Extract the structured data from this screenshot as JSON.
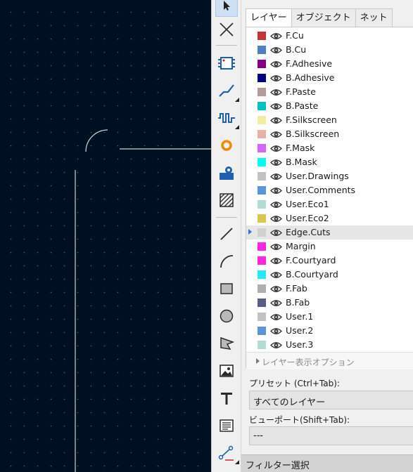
{
  "tabs": [
    {
      "label": "レイヤー",
      "active": true
    },
    {
      "label": "オブジェクト",
      "active": false
    },
    {
      "label": "ネット",
      "active": false
    }
  ],
  "layers": [
    {
      "name": "F.Cu",
      "color": "#c83434",
      "selected": false
    },
    {
      "name": "B.Cu",
      "color": "#4d7fc4",
      "selected": false
    },
    {
      "name": "F.Adhesive",
      "color": "#840084",
      "selected": false
    },
    {
      "name": "B.Adhesive",
      "color": "#000084",
      "selected": false
    },
    {
      "name": "F.Paste",
      "color": "#b49b9b",
      "selected": false
    },
    {
      "name": "B.Paste",
      "color": "#00c2c2",
      "selected": false
    },
    {
      "name": "F.Silkscreen",
      "color": "#f2eda1",
      "selected": false
    },
    {
      "name": "B.Silkscreen",
      "color": "#e8b2a7",
      "selected": false
    },
    {
      "name": "F.Mask",
      "color": "#d864ff",
      "selected": false
    },
    {
      "name": "B.Mask",
      "color": "#02ffee",
      "selected": false
    },
    {
      "name": "User.Drawings",
      "color": "#c2c2c2",
      "selected": false
    },
    {
      "name": "User.Comments",
      "color": "#5994dc",
      "selected": false
    },
    {
      "name": "User.Eco1",
      "color": "#b4dbd2",
      "selected": false
    },
    {
      "name": "User.Eco2",
      "color": "#d8c852",
      "selected": false
    },
    {
      "name": "Edge.Cuts",
      "color": "#d0d2cd",
      "selected": true
    },
    {
      "name": "Margin",
      "color": "#ff26e2",
      "selected": false
    },
    {
      "name": "F.Courtyard",
      "color": "#ff26e2",
      "selected": false
    },
    {
      "name": "B.Courtyard",
      "color": "#26e9ff",
      "selected": false
    },
    {
      "name": "F.Fab",
      "color": "#afafaf",
      "selected": false
    },
    {
      "name": "B.Fab",
      "color": "#585d84",
      "selected": false
    },
    {
      "name": "User.1",
      "color": "#c2c2c2",
      "selected": false
    },
    {
      "name": "User.2",
      "color": "#5994dc",
      "selected": false
    },
    {
      "name": "User.3",
      "color": "#b4dbd2",
      "selected": false
    }
  ],
  "layer_display_options": "レイヤー表示オプション",
  "preset": {
    "label": "プリセット (Ctrl+Tab):",
    "value": "すべてのレイヤー"
  },
  "viewport": {
    "label": "ビューポート(Shift+Tab):",
    "value": "---"
  },
  "filter_section": "フィルター選択",
  "toolbar_tools": [
    "select-tool",
    "local-ratsnest-tool",
    "footprint-tool",
    "route-track-tool",
    "tune-length-tool",
    "via-tool",
    "add-pad-tool",
    "zone-tool",
    "line-tool",
    "arc-tool",
    "rectangle-tool",
    "circle-tool",
    "polygon-tool",
    "image-tool",
    "text-tool",
    "textbox-tool",
    "dimension-tool"
  ],
  "colors": {
    "canvas_background": "#001023",
    "edge_cuts": "#d0d2cd",
    "accent": "#3b6fd6"
  }
}
